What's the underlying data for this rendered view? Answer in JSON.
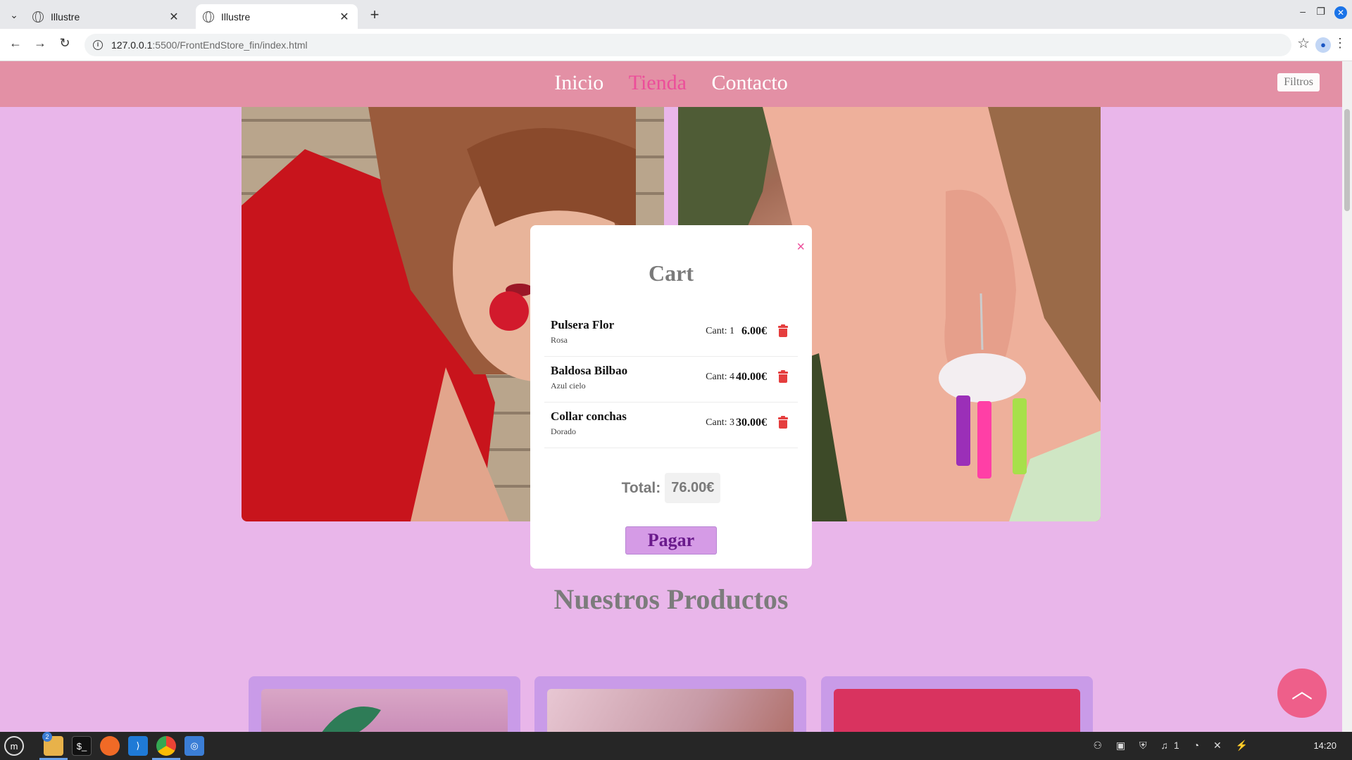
{
  "browser": {
    "tabs": [
      {
        "title": "Illustre",
        "active": false
      },
      {
        "title": "Illustre",
        "active": true
      }
    ],
    "url_host": "127.0.0.1",
    "url_path": ":5500/FrontEndStore_fin/index.html"
  },
  "site": {
    "nav": [
      {
        "label": "Inicio",
        "current": false
      },
      {
        "label": "Tienda",
        "current": true
      },
      {
        "label": "Contacto",
        "current": false
      }
    ],
    "filters_label": "Filtros",
    "products_title": "Nuestros Productos"
  },
  "cart": {
    "title": "Cart",
    "close_symbol": "×",
    "items": [
      {
        "name": "Pulsera Flor",
        "variant": "Rosa",
        "qty": "Cant: 1",
        "price": "6.00€"
      },
      {
        "name": "Baldosa Bilbao",
        "variant": "Azul cielo",
        "qty": "Cant: 4",
        "price": "40.00€"
      },
      {
        "name": "Collar conchas",
        "variant": "Dorado",
        "qty": "Cant: 3",
        "price": "30.00€"
      }
    ],
    "total_label": "Total:",
    "total_value": "76.00€",
    "pay_label": "Pagar"
  },
  "taskbar": {
    "clock": "14:20",
    "file_badge": "2",
    "tray_count": "1"
  },
  "colors": {
    "page_bg": "#e9b6ea",
    "header_bg": "#e390a5",
    "active_nav": "#ec4e9a",
    "pay_bg": "#d59be6",
    "trash": "#e53e3e",
    "scroll_top_bg": "#ee5f8a"
  }
}
